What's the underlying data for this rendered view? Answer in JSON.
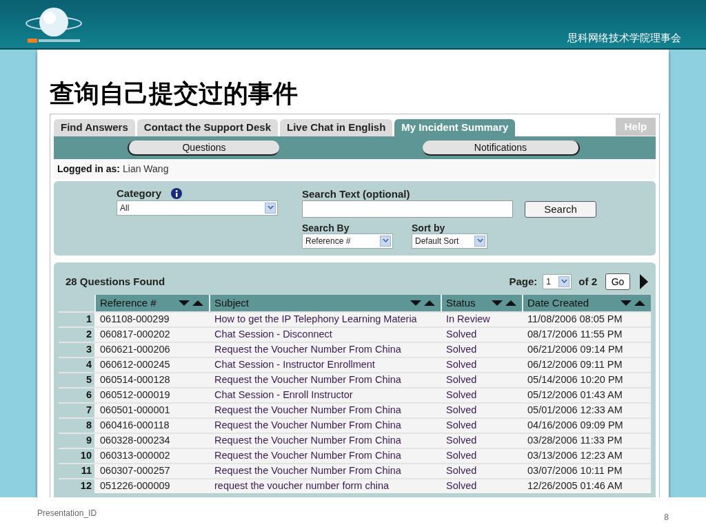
{
  "header": {
    "org": "思科网络技术学院理事会"
  },
  "slide": {
    "title": "查询自己提交过的事件"
  },
  "tabs": [
    {
      "label": "Find Answers",
      "selected": false
    },
    {
      "label": "Contact the  Support Desk",
      "selected": false
    },
    {
      "label": "Live Chat in English",
      "selected": false
    },
    {
      "label": "My Incident Summary",
      "selected": true
    }
  ],
  "help": "Help",
  "subnav": [
    {
      "label": "Questions"
    },
    {
      "label": "Notifications"
    }
  ],
  "login": {
    "label": "Logged in as:",
    "user": "Lian Wang"
  },
  "search": {
    "category_label": "Category",
    "category_value": "All",
    "text_label": "Search Text (optional)",
    "button": "Search",
    "search_by_label": "Search By",
    "search_by_value": "Reference #",
    "sort_label": "Sort by",
    "sort_value": "Default Sort"
  },
  "results": {
    "count": "28 Questions Found",
    "page_label": "Page:",
    "page_value": "1",
    "of": "of 2",
    "go": "Go"
  },
  "table": {
    "columns": [
      "",
      "Reference #",
      "Subject",
      "Status",
      "Date Created"
    ],
    "rows": [
      [
        "1",
        "061108-000299",
        "How to get the IP Telephony Learning Materia",
        "In Review",
        "11/08/2006 08:05 PM"
      ],
      [
        "2",
        "060817-000202",
        "Chat Session - Disconnect",
        "Solved",
        "08/17/2006 11:55 PM"
      ],
      [
        "3",
        "060621-000206",
        "Request the Voucher Number From China",
        "Solved",
        "06/21/2006 09:14 PM"
      ],
      [
        "4",
        "060612-000245",
        "Chat Session - Instructor Enrollment",
        "Solved",
        "06/12/2006 09:11 PM"
      ],
      [
        "5",
        "060514-000128",
        "Request the Voucher Number From China",
        "Solved",
        "05/14/2006 10:20 PM"
      ],
      [
        "6",
        "060512-000019",
        "Chat Session - Enroll Instructor",
        "Solved",
        "05/12/2006 01:43 AM"
      ],
      [
        "7",
        "060501-000001",
        "Request the Voucher Number From China",
        "Solved",
        "05/01/2006 12:33 AM"
      ],
      [
        "8",
        "060416-000118",
        "Request the Voucher Number From China",
        "Solved",
        "04/16/2006 09:09 PM"
      ],
      [
        "9",
        "060328-000234",
        "Request the Voucher Number From China",
        "Solved",
        "03/28/2006 11:33 PM"
      ],
      [
        "10",
        "060313-000002",
        "Request the Voucher Number From China",
        "Solved",
        "03/13/2006 12:23 AM"
      ],
      [
        "11",
        "060307-000257",
        "Request the Voucher Number From China",
        "Solved",
        "03/07/2006 10:11 PM"
      ],
      [
        "12",
        "051226-000009",
        "request the voucher number form china",
        "Solved",
        "12/26/2005 01:46 AM"
      ]
    ]
  },
  "footer": {
    "presentation_id": "Presentation_ID",
    "page_number": "8"
  }
}
